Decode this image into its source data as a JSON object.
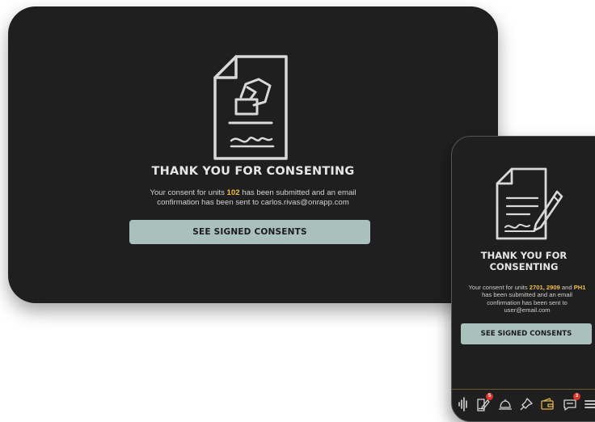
{
  "tablet": {
    "title": "THANK YOU FOR CONSENTING",
    "message": {
      "prefix": "Your consent for units ",
      "units": "102",
      "middle": " has been submitted and an email confirmation has been sent to ",
      "email": "carlos.rivas@onrapp.com"
    },
    "button_label": "SEE SIGNED CONSENTS"
  },
  "phone": {
    "title_line1": "THANK YOU FOR",
    "title_line2": "CONSENTING",
    "message": {
      "prefix": "Your consent for units ",
      "units": "2701, 2909",
      "and": " and ",
      "units2": "PH1",
      "middle": " has been submitted and an email confirmation has been sent to ",
      "email": "user@email.com"
    },
    "button_label": "SEE SIGNED CONSENTS",
    "tabbar": [
      {
        "icon": "waveform-icon"
      },
      {
        "icon": "sign-document-icon",
        "badge": "5"
      },
      {
        "icon": "service-bell-icon"
      },
      {
        "icon": "pin-icon"
      },
      {
        "icon": "wallet-icon"
      },
      {
        "icon": "chat-icon",
        "badge": "3"
      },
      {
        "icon": "menu-icon"
      }
    ]
  },
  "colors": {
    "background": "#1f1f1f",
    "accent": "#f1bf48",
    "button": "#a9c0bc",
    "badge": "#e2342d"
  }
}
